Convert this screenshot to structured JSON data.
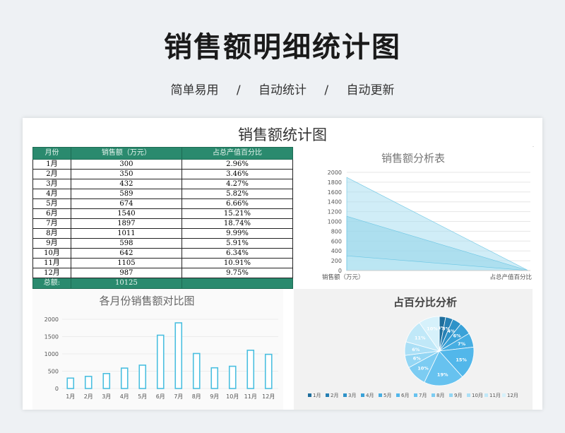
{
  "hero": {
    "title": "销售额明细统计图",
    "tags": [
      "简单易用",
      "/",
      "自动统计",
      "/",
      "自动更新"
    ]
  },
  "sheet": {
    "title": "销售额统计图",
    "table": {
      "headers": [
        "月份",
        "销售额（万元）",
        "占总产值百分比"
      ],
      "rows": [
        [
          "1月",
          "300",
          "2.96%"
        ],
        [
          "2月",
          "350",
          "3.46%"
        ],
        [
          "3月",
          "432",
          "4.27%"
        ],
        [
          "4月",
          "589",
          "5.82%"
        ],
        [
          "5月",
          "674",
          "6.66%"
        ],
        [
          "6月",
          "1540",
          "15.21%"
        ],
        [
          "7月",
          "1897",
          "18.74%"
        ],
        [
          "8月",
          "1011",
          "9.99%"
        ],
        [
          "9月",
          "598",
          "5.91%"
        ],
        [
          "10月",
          "642",
          "6.34%"
        ],
        [
          "11月",
          "1105",
          "10.91%"
        ],
        [
          "12月",
          "987",
          "9.75%"
        ]
      ],
      "total_label": "总额:",
      "total_value": "10125"
    }
  },
  "colors": {
    "header_green": "#2a8a6e",
    "bar_stroke": "#4bbfe0",
    "area_fill": "#8fd3ea"
  },
  "chart_data": [
    {
      "type": "area",
      "title": "销售额分析表",
      "categories": [
        "销售额（万元）",
        "占总产值百分比"
      ],
      "series": [
        {
          "values": [
            1897,
            0
          ]
        },
        {
          "values": [
            1105,
            0
          ]
        },
        {
          "values": [
            300,
            0
          ]
        }
      ],
      "yticks": [
        0,
        200,
        400,
        600,
        800,
        1000,
        1200,
        1400,
        1600,
        1800,
        2000
      ],
      "ylim": [
        0,
        2000
      ],
      "grid": true
    },
    {
      "type": "bar",
      "title": "各月份销售额对比图",
      "categories": [
        "1月",
        "2月",
        "3月",
        "4月",
        "5月",
        "6月",
        "7月",
        "8月",
        "9月",
        "10月",
        "11月",
        "12月"
      ],
      "values": [
        300,
        350,
        432,
        589,
        674,
        1540,
        1897,
        1011,
        598,
        642,
        1105,
        987
      ],
      "yticks": [
        0,
        500,
        1000,
        1500,
        2000
      ],
      "ylim": [
        0,
        2000
      ],
      "grid": true
    },
    {
      "type": "pie",
      "title": "占百分比分析",
      "categories": [
        "1月",
        "2月",
        "3月",
        "4月",
        "5月",
        "6月",
        "7月",
        "8月",
        "9月",
        "10月",
        "11月",
        "12月"
      ],
      "values": [
        2.96,
        3.46,
        4.27,
        5.82,
        6.66,
        15.21,
        18.74,
        9.99,
        5.91,
        6.34,
        10.91,
        9.75
      ],
      "labels": [
        "3%",
        "3%",
        "4%",
        "6%",
        "7%",
        "15%",
        "19%",
        "10%",
        "6%",
        "6%",
        "11%",
        "10%"
      ],
      "colors": [
        "#1f6e9c",
        "#2680b4",
        "#2e92c8",
        "#3aa2d8",
        "#47aee2",
        "#52b7ea",
        "#67c2ef",
        "#7cccf2",
        "#93d6f4",
        "#aadff6",
        "#c0e8f8",
        "#d6f1fb"
      ],
      "legend": "bottom"
    }
  ]
}
